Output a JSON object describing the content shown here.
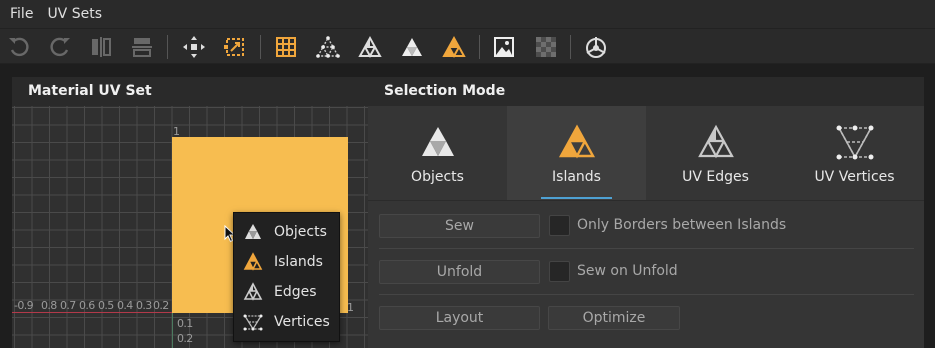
{
  "menubar": {
    "items": [
      "File",
      "UV Sets"
    ]
  },
  "toolbar": {
    "buttons": [
      "undo-icon",
      "redo-icon",
      "mirror-horizontal-icon",
      "mirror-vertical-icon",
      "transform-icon",
      "snap-icon",
      "grid-icon",
      "uv-vertices-mode-icon",
      "uv-edges-mode-icon",
      "objects-mode-icon",
      "islands-mode-icon",
      "texture-image-icon",
      "checkerboard-icon",
      "pivot-icon"
    ],
    "accent_color": "#f0a63c"
  },
  "left_panel": {
    "title": "Material UV Set",
    "y_axis_labels": [
      "1",
      "0.1",
      "0.2"
    ],
    "x_axis_labels": [
      "-0.9",
      "0.8",
      "0.7",
      "0.6",
      "0.5",
      "0.4",
      "0.3",
      "0.2"
    ],
    "x_axis_end_label": "1",
    "uv_fill_color": "#f7bd50"
  },
  "context_menu": {
    "items": [
      {
        "icon": "objects-icon",
        "label": "Objects"
      },
      {
        "icon": "islands-icon",
        "label": "Islands"
      },
      {
        "icon": "edges-icon",
        "label": "Edges"
      },
      {
        "icon": "vertices-icon",
        "label": "Vertices"
      }
    ]
  },
  "right_panel": {
    "title": "Selection Mode",
    "tabs": [
      {
        "label": "Objects",
        "icon": "objects-mode-icon",
        "active": false
      },
      {
        "label": "Islands",
        "icon": "islands-mode-icon",
        "active": true
      },
      {
        "label": "UV Edges",
        "icon": "uv-edges-mode-icon",
        "active": false
      },
      {
        "label": "UV Vertices",
        "icon": "uv-vertices-mode-icon",
        "active": false
      }
    ],
    "sew_button": "Sew",
    "only_borders_label": "Only Borders between Islands",
    "only_borders_checked": false,
    "unfold_button": "Unfold",
    "sew_on_unfold_label": "Sew on Unfold",
    "sew_on_unfold_checked": false,
    "layout_button": "Layout",
    "optimize_button": "Optimize"
  }
}
